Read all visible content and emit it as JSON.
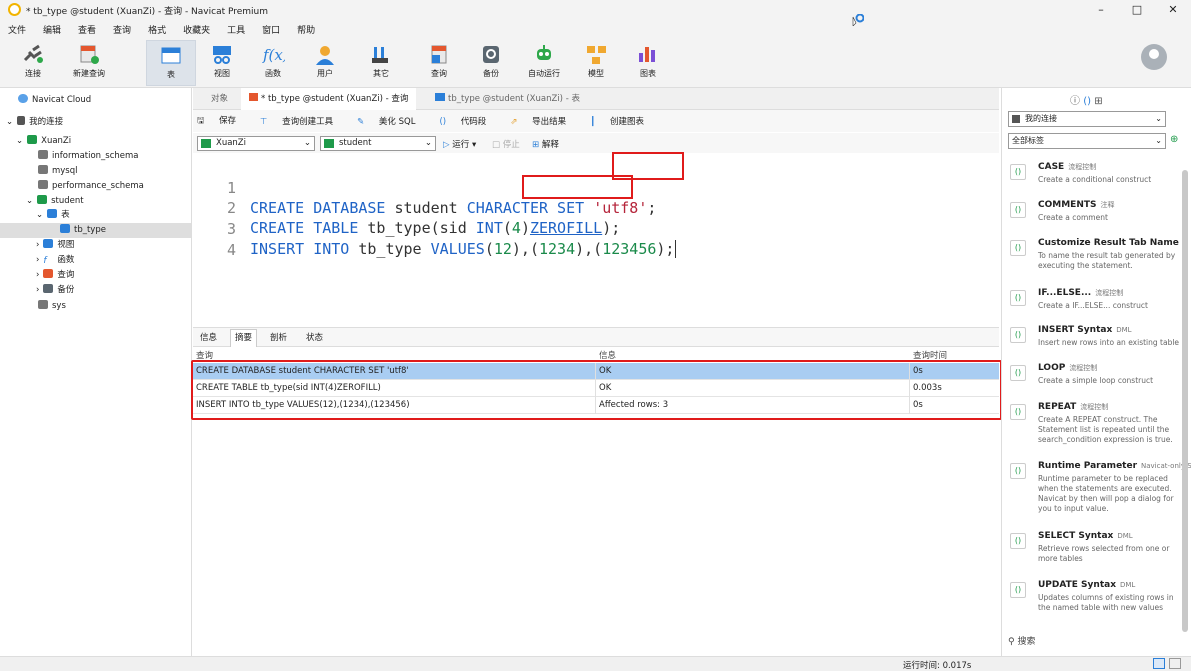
{
  "window": {
    "title": "* tb_type @student (XuanZi) - 查询 - Navicat Premium",
    "minimize": "–",
    "maximize": "□",
    "close": "✕"
  },
  "menu": [
    "文件",
    "编辑",
    "查看",
    "查询",
    "格式",
    "收藏夹",
    "工具",
    "窗口",
    "帮助"
  ],
  "toolbar": [
    {
      "label": "连接",
      "icon": "plug-icon"
    },
    {
      "label": "新建查询",
      "icon": "new-query-icon"
    },
    {
      "label": "表",
      "icon": "table-icon"
    },
    {
      "label": "视图",
      "icon": "view-icon"
    },
    {
      "label": "函数",
      "icon": "function-icon"
    },
    {
      "label": "用户",
      "icon": "user-icon"
    },
    {
      "label": "其它",
      "icon": "tools-icon"
    },
    {
      "label": "查询",
      "icon": "query-icon"
    },
    {
      "label": "备份",
      "icon": "backup-icon"
    },
    {
      "label": "自动运行",
      "icon": "robot-icon"
    },
    {
      "label": "模型",
      "icon": "model-icon"
    },
    {
      "label": "图表",
      "icon": "chart-icon"
    }
  ],
  "tree": {
    "cloud": "Navicat Cloud",
    "my_conn": "我的连接",
    "conn": "XuanZi",
    "dbs": [
      "information_schema",
      "mysql",
      "performance_schema",
      "student"
    ],
    "tables_group": "表",
    "table": "tb_type",
    "groups": [
      "视图",
      "函数",
      "查询",
      "备份"
    ],
    "sys": "sys"
  },
  "tabs": {
    "objects": "对象",
    "query_tab": "* tb_type @student (XuanZi) - 查询",
    "table_tab": "tb_type @student (XuanZi) - 表"
  },
  "editor_toolbar": {
    "save": "保存",
    "builder": "查询创建工具",
    "beautify": "美化 SQL",
    "snippet": "代码段",
    "export": "导出结果",
    "chart": "创建图表"
  },
  "selectors": {
    "connection": "XuanZi",
    "database": "student",
    "run": "运行",
    "stop": "停止",
    "explain": "解释"
  },
  "code": {
    "line1": {
      "n": "1",
      "a": "CREATE DATABASE",
      "b": " student ",
      "c": "CHARACTER SET",
      "d": " ",
      "e": "'utf8'",
      "f": ";"
    },
    "line2": {
      "n": "2",
      "a": "CREATE TABLE",
      "b": " tb_type(sid ",
      "c": "INT",
      "d": "(",
      "e": "4",
      "f": ")",
      "g": "ZEROFILL",
      "h": ");"
    },
    "line3": {
      "n": "3",
      "a": "INSERT INTO",
      "b": " tb_type ",
      "c": "VALUES",
      "d": "(",
      "e": "12",
      "f": "),(",
      "g": "1234",
      "h": "),(",
      "i": "123456",
      "j": ");"
    },
    "line4": {
      "n": "4"
    }
  },
  "result_tabs": [
    "信息",
    "摘要",
    "剖析",
    "状态"
  ],
  "grid": {
    "headers": [
      "查询",
      "信息",
      "查询时间"
    ],
    "rows": [
      [
        "CREATE DATABASE student CHARACTER SET 'utf8'",
        "OK",
        "0s"
      ],
      [
        "CREATE TABLE tb_type(sid INT(4)ZEROFILL)",
        "OK",
        "0.003s"
      ],
      [
        "INSERT INTO tb_type VALUES(12),(1234),(123456)",
        "Affected rows: 3",
        "0s"
      ]
    ]
  },
  "status": {
    "runtime": "运行时间: 0.017s"
  },
  "right": {
    "my_conn": "我的连接",
    "all_tags": "全部标签",
    "search": "搜索",
    "snippets": [
      {
        "title": "CASE",
        "tag": "流程控制",
        "desc": "Create a conditional construct"
      },
      {
        "title": "COMMENTS",
        "tag": "注释",
        "desc": "Create a comment"
      },
      {
        "title": "Customize Result Tab Name",
        "tag": "N",
        "desc": "To name the result tab generated by executing the statement."
      },
      {
        "title": "IF...ELSE...",
        "tag": "流程控制",
        "desc": "Create a IF...ELSE... construct"
      },
      {
        "title": "INSERT Syntax",
        "tag": "DML",
        "desc": "Insert new rows into an existing table"
      },
      {
        "title": "LOOP",
        "tag": "流程控制",
        "desc": "Create a simple loop construct"
      },
      {
        "title": "REPEAT",
        "tag": "流程控制",
        "desc": "Create A REPEAT construct. The Statement list is repeated until the search_condition expression is true."
      },
      {
        "title": "Runtime Parameter",
        "tag": "Navicat-only S",
        "desc": "Runtime parameter to be replaced when the statements are executed. Navicat by then will pop a dialog for you to input value."
      },
      {
        "title": "SELECT Syntax",
        "tag": "DML",
        "desc": "Retrieve rows selected from one or more tables"
      },
      {
        "title": "UPDATE Syntax",
        "tag": "DML",
        "desc": "Updates columns of existing rows in the named table with new values"
      }
    ]
  },
  "colors": {
    "accent": "#1f63c6",
    "highlight": "#e01b1b",
    "selection": "#a9cdf2"
  }
}
